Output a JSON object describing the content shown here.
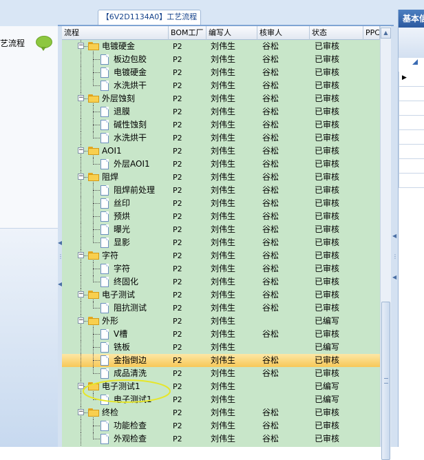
{
  "window": {
    "tab_title": "【6V2D1134A0】工艺流程"
  },
  "left_panel": {
    "item_label": "艺流程"
  },
  "right_panel": {
    "header": "基本信"
  },
  "grid": {
    "columns": [
      "流程",
      "BOM工厂",
      "编写人",
      "核审人",
      "状态",
      "PPC"
    ],
    "rows": [
      {
        "name": "电镀硬金",
        "level": 1,
        "type": "folder",
        "bom": "P2",
        "writer": "刘伟生",
        "reviewer": "谷松",
        "status": "已审核"
      },
      {
        "name": "板边包胶",
        "level": 2,
        "type": "doc",
        "bom": "P2",
        "writer": "刘伟生",
        "reviewer": "谷松",
        "status": "已审核"
      },
      {
        "name": "电镀硬金",
        "level": 2,
        "type": "doc",
        "bom": "P2",
        "writer": "刘伟生",
        "reviewer": "谷松",
        "status": "已审核"
      },
      {
        "name": "水洗烘干",
        "level": 2,
        "type": "doc",
        "bom": "P2",
        "writer": "刘伟生",
        "reviewer": "谷松",
        "status": "已审核"
      },
      {
        "name": "外层蚀刻",
        "level": 1,
        "type": "folder",
        "bom": "P2",
        "writer": "刘伟生",
        "reviewer": "谷松",
        "status": "已审核"
      },
      {
        "name": "退膜",
        "level": 2,
        "type": "doc",
        "bom": "P2",
        "writer": "刘伟生",
        "reviewer": "谷松",
        "status": "已审核"
      },
      {
        "name": "碱性蚀刻",
        "level": 2,
        "type": "doc",
        "bom": "P2",
        "writer": "刘伟生",
        "reviewer": "谷松",
        "status": "已审核"
      },
      {
        "name": "水洗烘干",
        "level": 2,
        "type": "doc",
        "bom": "P2",
        "writer": "刘伟生",
        "reviewer": "谷松",
        "status": "已审核"
      },
      {
        "name": "AOI1",
        "level": 1,
        "type": "folder",
        "bom": "P2",
        "writer": "刘伟生",
        "reviewer": "谷松",
        "status": "已审核"
      },
      {
        "name": "外层AOI1",
        "level": 2,
        "type": "doc",
        "bom": "P2",
        "writer": "刘伟生",
        "reviewer": "谷松",
        "status": "已审核"
      },
      {
        "name": "阻焊",
        "level": 1,
        "type": "folder",
        "bom": "P2",
        "writer": "刘伟生",
        "reviewer": "谷松",
        "status": "已审核"
      },
      {
        "name": "阻焊前处理",
        "level": 2,
        "type": "doc",
        "bom": "P2",
        "writer": "刘伟生",
        "reviewer": "谷松",
        "status": "已审核"
      },
      {
        "name": "丝印",
        "level": 2,
        "type": "doc",
        "bom": "P2",
        "writer": "刘伟生",
        "reviewer": "谷松",
        "status": "已审核"
      },
      {
        "name": "预烘",
        "level": 2,
        "type": "doc",
        "bom": "P2",
        "writer": "刘伟生",
        "reviewer": "谷松",
        "status": "已审核"
      },
      {
        "name": "曝光",
        "level": 2,
        "type": "doc",
        "bom": "P2",
        "writer": "刘伟生",
        "reviewer": "谷松",
        "status": "已审核"
      },
      {
        "name": "显影",
        "level": 2,
        "type": "doc",
        "bom": "P2",
        "writer": "刘伟生",
        "reviewer": "谷松",
        "status": "已审核"
      },
      {
        "name": "字符",
        "level": 1,
        "type": "folder",
        "bom": "P2",
        "writer": "刘伟生",
        "reviewer": "谷松",
        "status": "已审核"
      },
      {
        "name": "字符",
        "level": 2,
        "type": "doc",
        "bom": "P2",
        "writer": "刘伟生",
        "reviewer": "谷松",
        "status": "已审核"
      },
      {
        "name": "终固化",
        "level": 2,
        "type": "doc",
        "bom": "P2",
        "writer": "刘伟生",
        "reviewer": "谷松",
        "status": "已审核"
      },
      {
        "name": "电子测试",
        "level": 1,
        "type": "folder",
        "bom": "P2",
        "writer": "刘伟生",
        "reviewer": "谷松",
        "status": "已审核"
      },
      {
        "name": "阻抗测试",
        "level": 2,
        "type": "doc",
        "bom": "P2",
        "writer": "刘伟生",
        "reviewer": "谷松",
        "status": "已审核"
      },
      {
        "name": "外形",
        "level": 1,
        "type": "folder",
        "bom": "P2",
        "writer": "刘伟生",
        "reviewer": "",
        "status": "已编写"
      },
      {
        "name": "V槽",
        "level": 2,
        "type": "doc",
        "bom": "P2",
        "writer": "刘伟生",
        "reviewer": "谷松",
        "status": "已审核"
      },
      {
        "name": "铣板",
        "level": 2,
        "type": "doc",
        "bom": "P2",
        "writer": "刘伟生",
        "reviewer": "",
        "status": "已编写"
      },
      {
        "name": "金指倒边",
        "level": 2,
        "type": "doc",
        "bom": "P2",
        "writer": "刘伟生",
        "reviewer": "谷松",
        "status": "已审核",
        "selected": true
      },
      {
        "name": "成品清洗",
        "level": 2,
        "type": "doc",
        "bom": "P2",
        "writer": "刘伟生",
        "reviewer": "谷松",
        "status": "已审核"
      },
      {
        "name": "电子测试1",
        "level": 1,
        "type": "folder",
        "bom": "P2",
        "writer": "刘伟生",
        "reviewer": "",
        "status": "已编写"
      },
      {
        "name": "电子测试1",
        "level": 2,
        "type": "doc",
        "bom": "P2",
        "writer": "刘伟生",
        "reviewer": "",
        "status": "已编写"
      },
      {
        "name": "终检",
        "level": 1,
        "type": "folder",
        "bom": "P2",
        "writer": "刘伟生",
        "reviewer": "谷松",
        "status": "已审核"
      },
      {
        "name": "功能检查",
        "level": 2,
        "type": "doc",
        "bom": "P2",
        "writer": "刘伟生",
        "reviewer": "谷松",
        "status": "已审核"
      },
      {
        "name": "外观检查",
        "level": 2,
        "type": "doc",
        "bom": "P2",
        "writer": "刘伟生",
        "reviewer": "谷松",
        "status": "已审核"
      }
    ]
  },
  "colors": {
    "grid_bg": "#c8e6c9",
    "selection": "#f7c858",
    "annotation": "#e6e62a"
  }
}
